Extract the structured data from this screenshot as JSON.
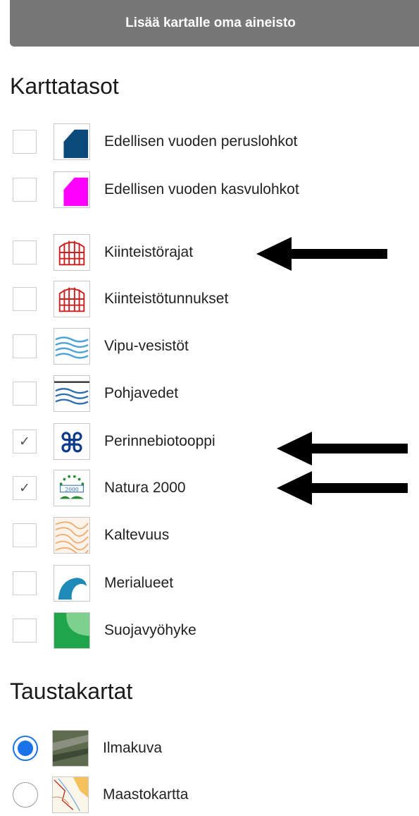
{
  "top_button": {
    "label": "Lisää kartalle oma aineisto"
  },
  "layers_section": {
    "title": "Karttatasot",
    "items": [
      {
        "label": "Edellisen vuoden peruslohkot",
        "checked": false,
        "icon": "blue-parcel-icon"
      },
      {
        "label": "Edellisen vuoden kasvulohkot",
        "checked": false,
        "icon": "magenta-parcel-icon"
      },
      {
        "label": "Kiinteistörajat",
        "checked": false,
        "icon": "red-fence-icon"
      },
      {
        "label": "Kiinteistötunnukset",
        "checked": false,
        "icon": "red-fence-icon"
      },
      {
        "label": "Vipu-vesistöt",
        "checked": false,
        "icon": "water-waves-icon"
      },
      {
        "label": "Pohjavedet",
        "checked": false,
        "icon": "groundwater-icon"
      },
      {
        "label": "Perinnebiotooppi",
        "checked": true,
        "icon": "command-symbol-icon"
      },
      {
        "label": "Natura 2000",
        "checked": true,
        "icon": "natura-2000-icon"
      },
      {
        "label": "Kaltevuus",
        "checked": false,
        "icon": "contour-icon"
      },
      {
        "label": "Merialueet",
        "checked": false,
        "icon": "wave-icon"
      },
      {
        "label": "Suojavyöhyke",
        "checked": false,
        "icon": "buffer-zone-icon"
      }
    ],
    "check_mark": "✓"
  },
  "background_section": {
    "title": "Taustakartat",
    "items": [
      {
        "label": "Ilmakuva",
        "selected": true,
        "icon": "aerial-photo-icon"
      },
      {
        "label": "Maastokartta",
        "selected": false,
        "icon": "terrain-map-icon"
      }
    ]
  },
  "natura_icon_text": "2000",
  "colors": {
    "button_bg": "#777777",
    "accent_blue": "#1a73e8",
    "parcel_blue": "#0a4a7a",
    "parcel_magenta": "#ff00ff",
    "fence_red": "#cc1f1f",
    "water_blue": "#4aa3d8",
    "buffer_green": "#1fa64a"
  }
}
